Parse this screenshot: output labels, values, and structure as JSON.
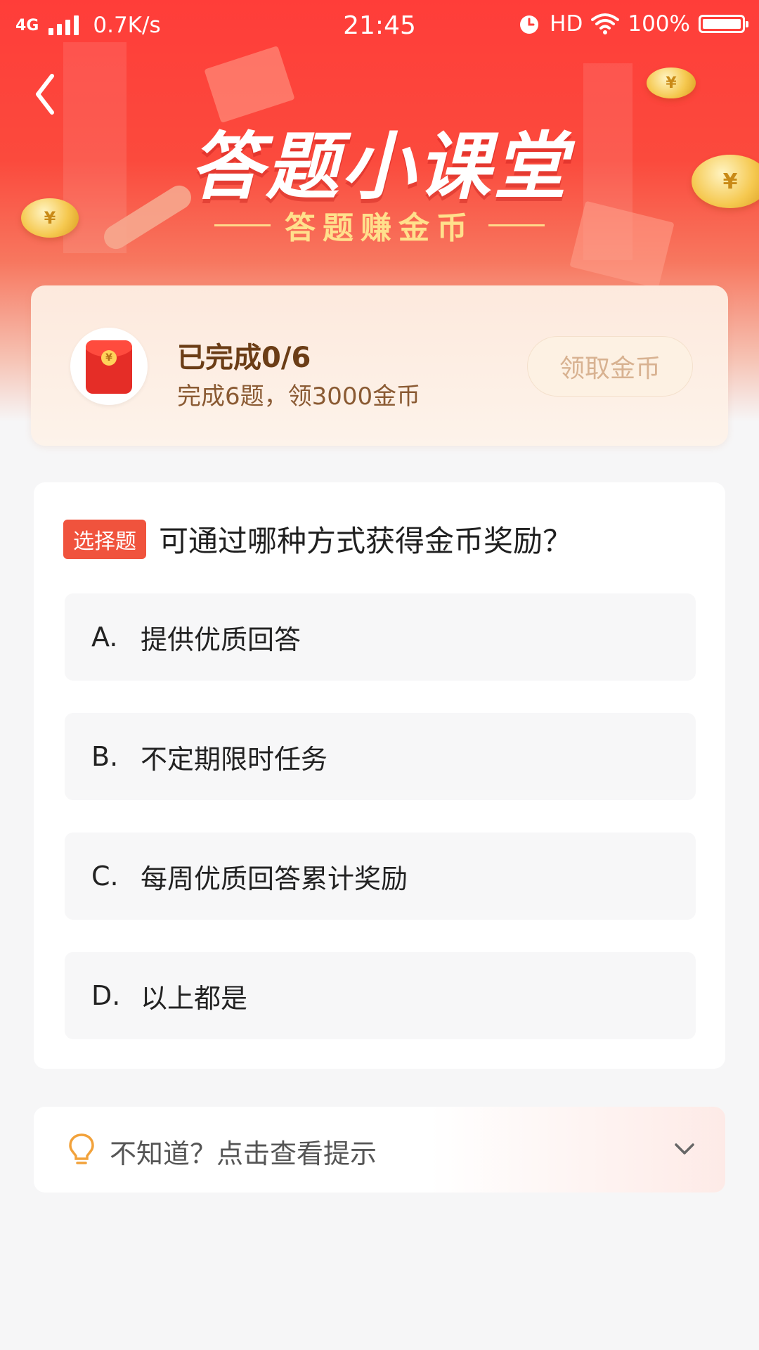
{
  "status_bar": {
    "network": "4G",
    "speed": "0.7K/s",
    "time": "21:45",
    "hd": "HD",
    "battery": "100%"
  },
  "header": {
    "title": "答题小课堂",
    "subtitle": "答题赚金币"
  },
  "progress": {
    "title": "已完成0/6",
    "description": "完成6题，领3000金币",
    "claim_button": "领取金币",
    "completed": 0,
    "total": 6
  },
  "question": {
    "tag": "选择题",
    "text": "可通过哪种方式获得金币奖励？",
    "options": [
      {
        "letter": "A.",
        "text": "提供优质回答"
      },
      {
        "letter": "B.",
        "text": "不定期限时任务"
      },
      {
        "letter": "C.",
        "text": "每周优质回答累计奖励"
      },
      {
        "letter": "D.",
        "text": "以上都是"
      }
    ]
  },
  "hint": {
    "text": "不知道？点击查看提示"
  },
  "colors": {
    "brand_red": "#ff3d39",
    "tag_red": "#f0533d",
    "gold": "#ffe08c"
  },
  "icons": {
    "back": "back-arrow-icon",
    "hint": "lightbulb-icon",
    "expand": "chevron-down-icon",
    "reward": "red-envelope-icon"
  }
}
